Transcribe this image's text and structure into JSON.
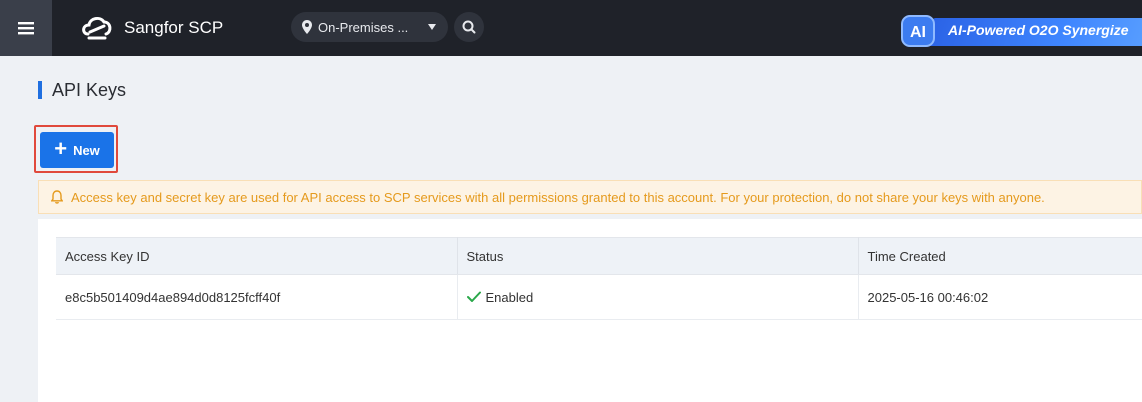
{
  "header": {
    "brand_name": "Sangfor SCP",
    "region_label": "On-Premises ...",
    "ai_banner_text": "AI-Powered O2O Synergize",
    "ai_badge_text": "AI"
  },
  "page": {
    "title": "API Keys",
    "new_button_label": "New"
  },
  "notice": {
    "text": "Access key and secret key are used for API access to SCP services with all permissions granted to this account. For your protection, do not share your keys with anyone."
  },
  "table": {
    "columns": [
      "Access Key ID",
      "Status",
      "Time Created"
    ],
    "rows": [
      {
        "access_key_id": "e8c5b501409d4ae894d0d8125fcff40f",
        "status": "Enabled",
        "time_created": "2025-05-16 00:46:02"
      }
    ]
  },
  "colors": {
    "accent": "#1a73e8",
    "topbar": "#1f2229",
    "warning": "#e59a1d",
    "success": "#2aa84a"
  },
  "icons": [
    "menu-icon",
    "cloud-logo-icon",
    "location-pin-icon",
    "search-icon",
    "bell-icon",
    "check-icon",
    "plus-icon"
  ]
}
